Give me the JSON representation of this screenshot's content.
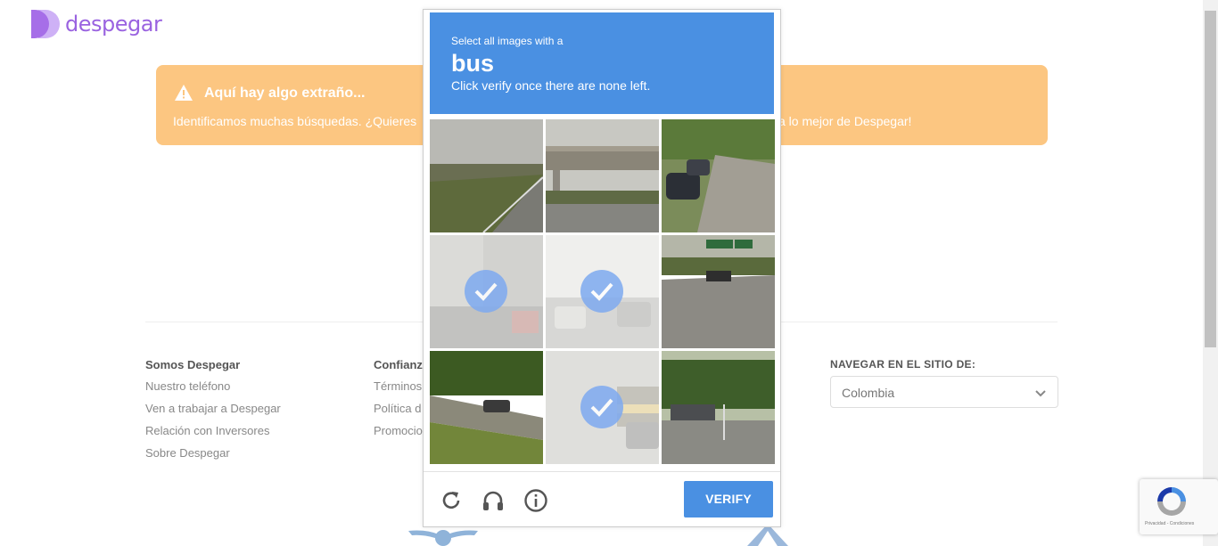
{
  "logo": {
    "text": "despegar"
  },
  "banner": {
    "title": "Aquí hay algo extraño...",
    "text_left": "Identificamos muchas búsquedas. ¿Quieres",
    "text_right": "a lo mejor de Despegar!",
    "icon": "warning-icon"
  },
  "footer": {
    "col1": {
      "heading": "Somos Despegar",
      "links": [
        "Nuestro teléfono",
        "Ven a trabajar a Despegar",
        "Relación con Inversores",
        "Sobre Despegar"
      ]
    },
    "col2": {
      "heading": "Confianz",
      "links": [
        "Términos",
        "Política d",
        "Promocio"
      ]
    },
    "site_nav": {
      "heading": "NAVEGAR EN EL SITIO DE:",
      "selected": "Colombia"
    }
  },
  "captcha": {
    "prompt_small": "Select all images with a",
    "target": "bus",
    "instruction": "Click verify once there are none left.",
    "verify_label": "VERIFY",
    "tiles": [
      {
        "selected": false
      },
      {
        "selected": false
      },
      {
        "selected": false
      },
      {
        "selected": true
      },
      {
        "selected": true
      },
      {
        "selected": false
      },
      {
        "selected": false
      },
      {
        "selected": true
      },
      {
        "selected": false
      }
    ],
    "icons": [
      "reload-icon",
      "audio-icon",
      "info-icon"
    ]
  },
  "recaptcha_badge": {
    "links": "Privacidad - Condiciones"
  },
  "colors": {
    "brand": "#9a63e0",
    "banner": "#fcc681",
    "captcha_blue": "#4a90e2"
  }
}
